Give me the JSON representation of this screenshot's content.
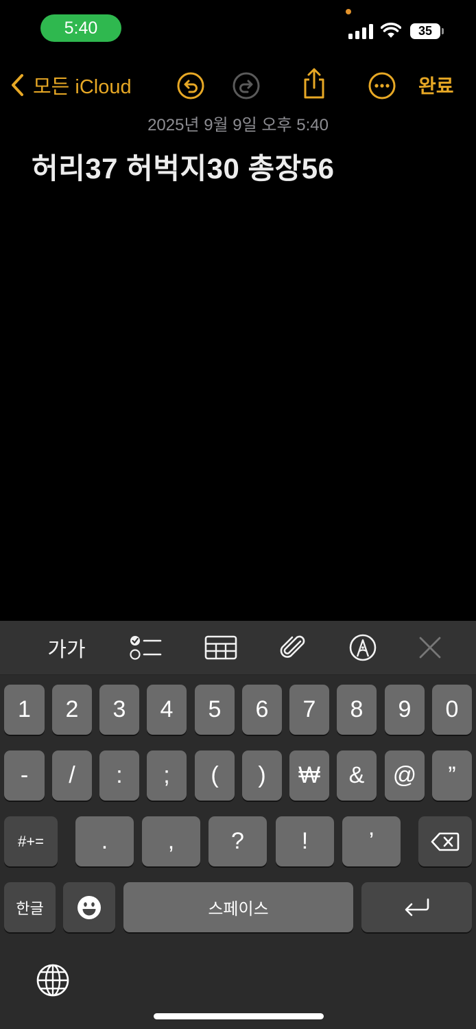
{
  "status_bar": {
    "time": "5:40",
    "battery": "35"
  },
  "nav": {
    "back_label": "모든 iCloud",
    "done_label": "완료"
  },
  "note": {
    "date": "2025년 9월 9일 오후 5:40",
    "title": "허리37 허벅지30 총장56"
  },
  "toolbar": {
    "format_label": "가가"
  },
  "keyboard": {
    "row1": [
      "1",
      "2",
      "3",
      "4",
      "5",
      "6",
      "7",
      "8",
      "9",
      "0"
    ],
    "row2": [
      "-",
      "/",
      ":",
      ";",
      "(",
      ")",
      "₩",
      "&",
      "@",
      "”"
    ],
    "row3_mode": "#+=",
    "row3": [
      ".",
      ",",
      "?",
      "!",
      "’"
    ],
    "lang_key": "한글",
    "space_label": "스페이스"
  },
  "colors": {
    "accent": "#e7a825",
    "time_pill": "#2fb84f",
    "key": "#6b6b6b",
    "key_dark": "#464646"
  }
}
